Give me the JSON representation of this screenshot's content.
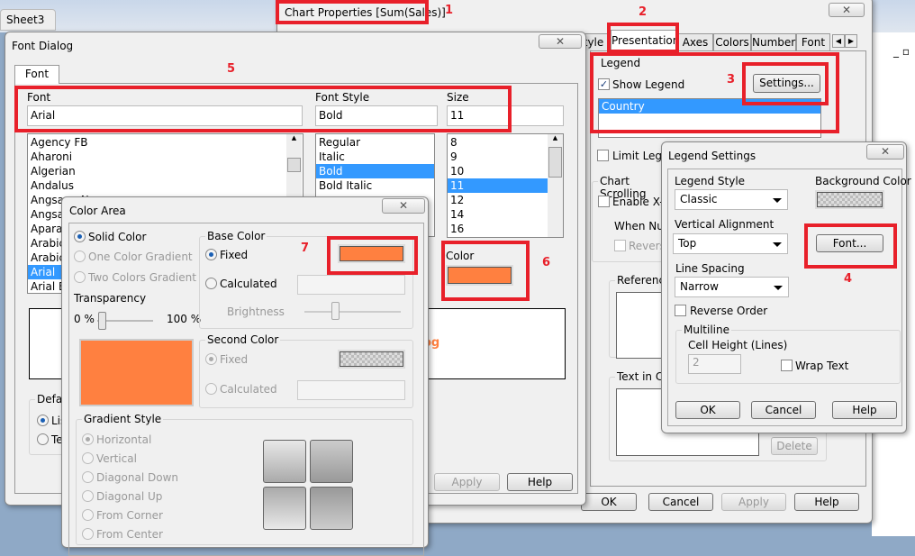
{
  "sheet_tab": "Sheet3",
  "colors": {
    "accent_orange": "#ff8040",
    "highlight": "#3399ff",
    "annotation_red": "#e8202a"
  },
  "annotations": [
    "1",
    "2",
    "3",
    "4",
    "5",
    "6",
    "7"
  ],
  "chart_props": {
    "title": "Chart Properties [Sum(Sales)]",
    "close": "✕",
    "tabs": [
      "tyle",
      "Presentation",
      "Axes",
      "Colors",
      "Number",
      "Font"
    ],
    "active_tab": "Presentation",
    "legend_group": "Legend",
    "show_legend": "Show Legend",
    "settings_btn": "Settings...",
    "legend_items": [
      "Country"
    ],
    "limit_legend": "Limit Legend",
    "chart_scrolling": "Chart Scrolling",
    "enable_x": "Enable X-A",
    "when_num": "When Num",
    "reverse": "Reverse",
    "reference": "Reference",
    "text_in_chart": "Text in Cha",
    "delete": "Delete",
    "ok": "OK",
    "cancel": "Cancel",
    "apply": "Apply",
    "help": "Help"
  },
  "font_dialog": {
    "title": "Font Dialog",
    "close": "✕",
    "tab": "Font",
    "font_label": "Font",
    "font_value": "Arial",
    "style_label": "Font Style",
    "style_value": "Bold",
    "size_label": "Size",
    "size_value": "11",
    "fonts": [
      "Agency FB",
      "Aharoni",
      "Algerian",
      "Andalus",
      "Angsana New",
      "AngsanaUPC",
      "Aparajita",
      "Arabic Typesetting",
      "Arabic Transparent",
      "Arial",
      "Arial Baltic"
    ],
    "selected_font": "Arial",
    "styles": [
      "Regular",
      "Italic",
      "Bold",
      "Bold Italic"
    ],
    "selected_style": "Bold",
    "sizes": [
      "8",
      "9",
      "10",
      "11",
      "12",
      "14",
      "16"
    ],
    "selected_size": "11",
    "color_label": "Color",
    "preview_text": "og",
    "default_group": "Default",
    "radio1": "List",
    "radio2": "Text",
    "apply": "Apply",
    "help": "Help"
  },
  "color_area": {
    "title": "Color Area",
    "close": "✕",
    "solid": "Solid Color",
    "one_grad": "One Color Gradient",
    "two_grad": "Two Colors Gradient",
    "transparency": "Transparency",
    "t_min": "0 %",
    "t_max": "100 %",
    "transparency_value": 0,
    "base_color": "Base Color",
    "fixed": "Fixed",
    "calculated": "Calculated",
    "brightness": "Brightness",
    "second_color": "Second Color",
    "fixed2": "Fixed",
    "calculated2": "Calculated",
    "gradient_style": "Gradient Style",
    "gradients": [
      "Horizontal",
      "Vertical",
      "Diagonal Down",
      "Diagonal Up",
      "From Corner",
      "From Center"
    ]
  },
  "legend_settings": {
    "title": "Legend Settings",
    "close": "✕",
    "legend_style_label": "Legend Style",
    "legend_style": "Classic",
    "bg_color": "Background Color",
    "valign_label": "Vertical Alignment",
    "valign": "Top",
    "font_btn": "Font...",
    "spacing_label": "Line Spacing",
    "spacing": "Narrow",
    "reverse_order": "Reverse Order",
    "multiline": "Multiline",
    "cell_height": "Cell Height (Lines)",
    "cell_value": "2",
    "wrap_text": "Wrap Text",
    "ok": "OK",
    "cancel": "Cancel",
    "help": "Help"
  }
}
